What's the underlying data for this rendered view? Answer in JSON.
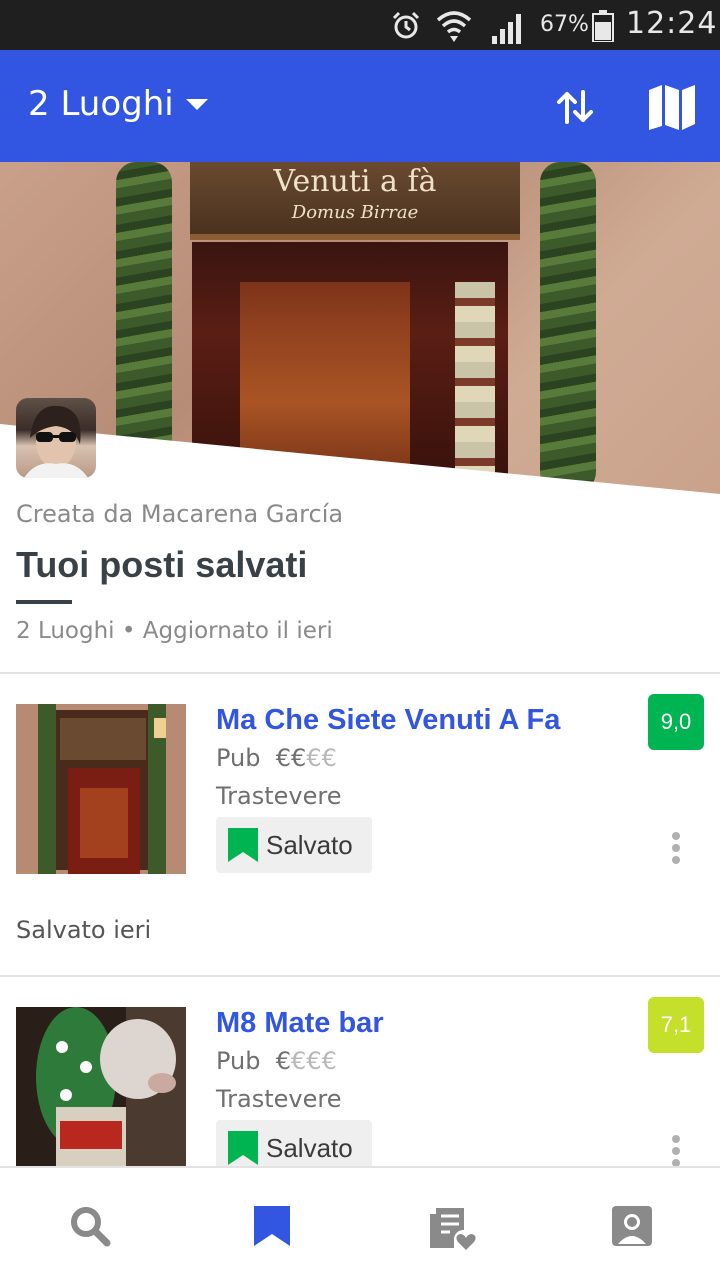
{
  "status_bar": {
    "battery": "67%",
    "time": "12:24",
    "icons": [
      "alarm-icon",
      "wifi-icon",
      "signal-icon",
      "battery-icon"
    ]
  },
  "app_bar": {
    "title": "2 Luoghi",
    "icons": [
      "chevron-down-icon",
      "sort-icon",
      "map-icon"
    ],
    "color": "#3256e2"
  },
  "list": {
    "creator": "Creata da Macarena García",
    "title": "Tuoi posti salvati",
    "meta": "2 Luoghi • Aggiornato il ieri"
  },
  "hero": {
    "sign_line1": "Venuti a fà",
    "sign_line2": "Domus Birrae"
  },
  "venues": [
    {
      "name": "Ma Che Siete Venuti A Fa",
      "category": "Pub",
      "price_on": "€€",
      "price_off": "€€",
      "area": "Trastevere",
      "saved_label": "Salvato",
      "score": "9,0",
      "score_color": "#00b551",
      "saved_when": "Salvato ieri"
    },
    {
      "name": "M8 Mate bar",
      "category": "Pub",
      "price_on": "€",
      "price_off": "€€€",
      "area": "Trastevere",
      "saved_label": "Salvato",
      "score": "7,1",
      "score_color": "#c5e02b"
    }
  ],
  "bottom_nav": {
    "items": [
      "search-icon",
      "bookmark-icon",
      "feed-icon",
      "profile-icon"
    ],
    "active": "bookmark-icon",
    "active_color": "#3256e2",
    "inactive_color": "#8a8a8a"
  }
}
